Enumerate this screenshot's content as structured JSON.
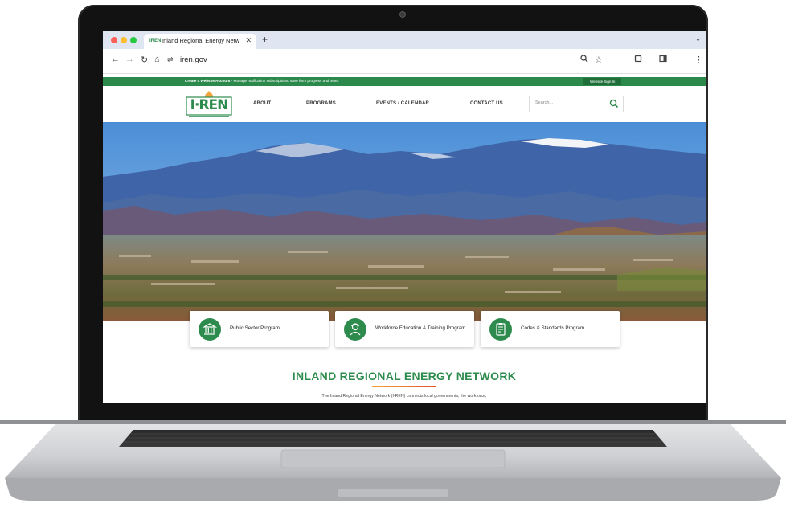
{
  "browser": {
    "tab_title": "Inland Regional Energy Netw",
    "tab_favicon": "IREN",
    "url": "iren.gov",
    "icons": [
      "back-icon",
      "forward-icon",
      "reload-icon",
      "home-icon",
      "tune-icon",
      "zoom-icon",
      "bookmark-star-icon",
      "extensions-icon",
      "sidepanel-icon",
      "menu-icon"
    ]
  },
  "site": {
    "topbar": {
      "bold_text": "Create a Website Account",
      "text": " - Manage notification subscriptions, save form progress and more.",
      "portal_button": "Website Sign In"
    },
    "logo_text": "I·REN",
    "nav": [
      "ABOUT",
      "PROGRAMS",
      "EVENTS / CALENDAR",
      "CONTACT US"
    ],
    "search_placeholder": "Search...",
    "cards": [
      {
        "label": "Public Sector Program",
        "icon": "government-building-icon"
      },
      {
        "label": "Workforce Education & Training Program",
        "icon": "worker-icon"
      },
      {
        "label": "Codes & Standards Program",
        "icon": "clipboard-icon"
      }
    ],
    "main_title": "INLAND REGIONAL ENERGY NETWORK",
    "intro": "The Inland Regional Energy Network (I-REN) connects local governments, the workforce,",
    "colors": {
      "brand_green": "#2e8b4e",
      "accent_orange": "#f2a33a"
    }
  }
}
